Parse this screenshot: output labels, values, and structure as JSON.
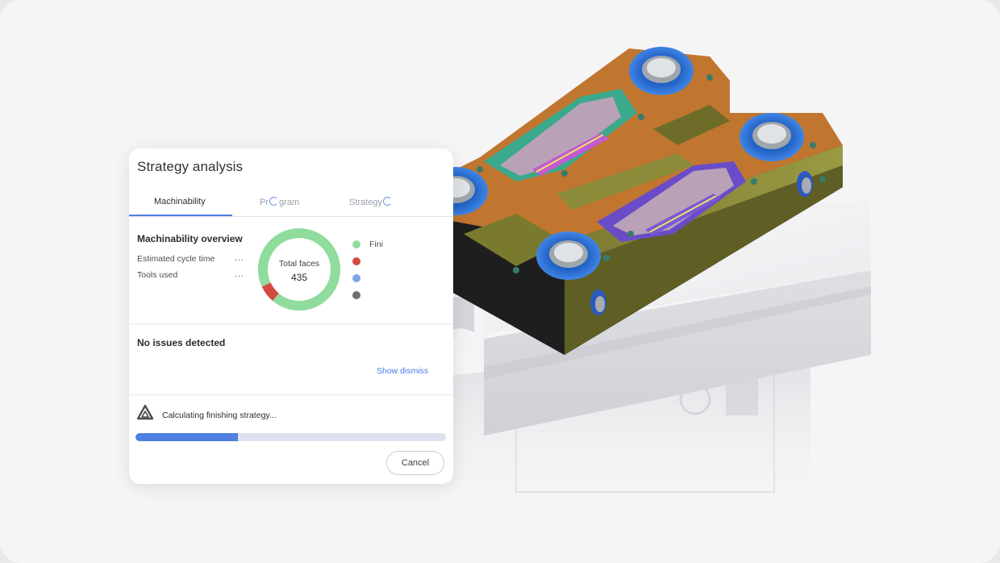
{
  "panel": {
    "title": "Strategy analysis",
    "tabs": [
      {
        "label": "Machinability",
        "active": true
      },
      {
        "label_prefix": "Pr",
        "label_suffix": "gram",
        "loading": true
      },
      {
        "label_prefix": "Strategy",
        "label_suffix": "",
        "loading": true
      }
    ],
    "overview": {
      "title": "Machinability overview",
      "rows": [
        {
          "label": "Estimated cycle time",
          "value": "..."
        },
        {
          "label": "Tools used",
          "value": "..."
        }
      ]
    },
    "donut": {
      "label": "Total faces",
      "value": "435",
      "segments": [
        {
          "color": "#8fdc9c",
          "fraction": 0.93
        },
        {
          "color": "#d54a3e",
          "fraction": 0.07
        }
      ]
    },
    "legend": [
      {
        "label": "Fini",
        "color": "#8fdc9c"
      },
      {
        "label": "",
        "color": "#d54a3e"
      },
      {
        "label": "",
        "color": "#7ea4ec"
      },
      {
        "label": "",
        "color": "#6f6f6f"
      }
    ],
    "issues": {
      "title": "No issues detected",
      "link": "Show dismiss"
    },
    "status": {
      "text": "Calculating finishing strategy...",
      "progress": 0.33
    },
    "cancel_label": "Cancel"
  },
  "colors": {
    "accent": "#4f7fe0",
    "part_orange": "#c0762f",
    "part_olive": "#8a8a36",
    "ring_blue": "#2f6fd0",
    "slot_teal": "#3aa98c",
    "slot_purple": "#6a4cc8"
  }
}
